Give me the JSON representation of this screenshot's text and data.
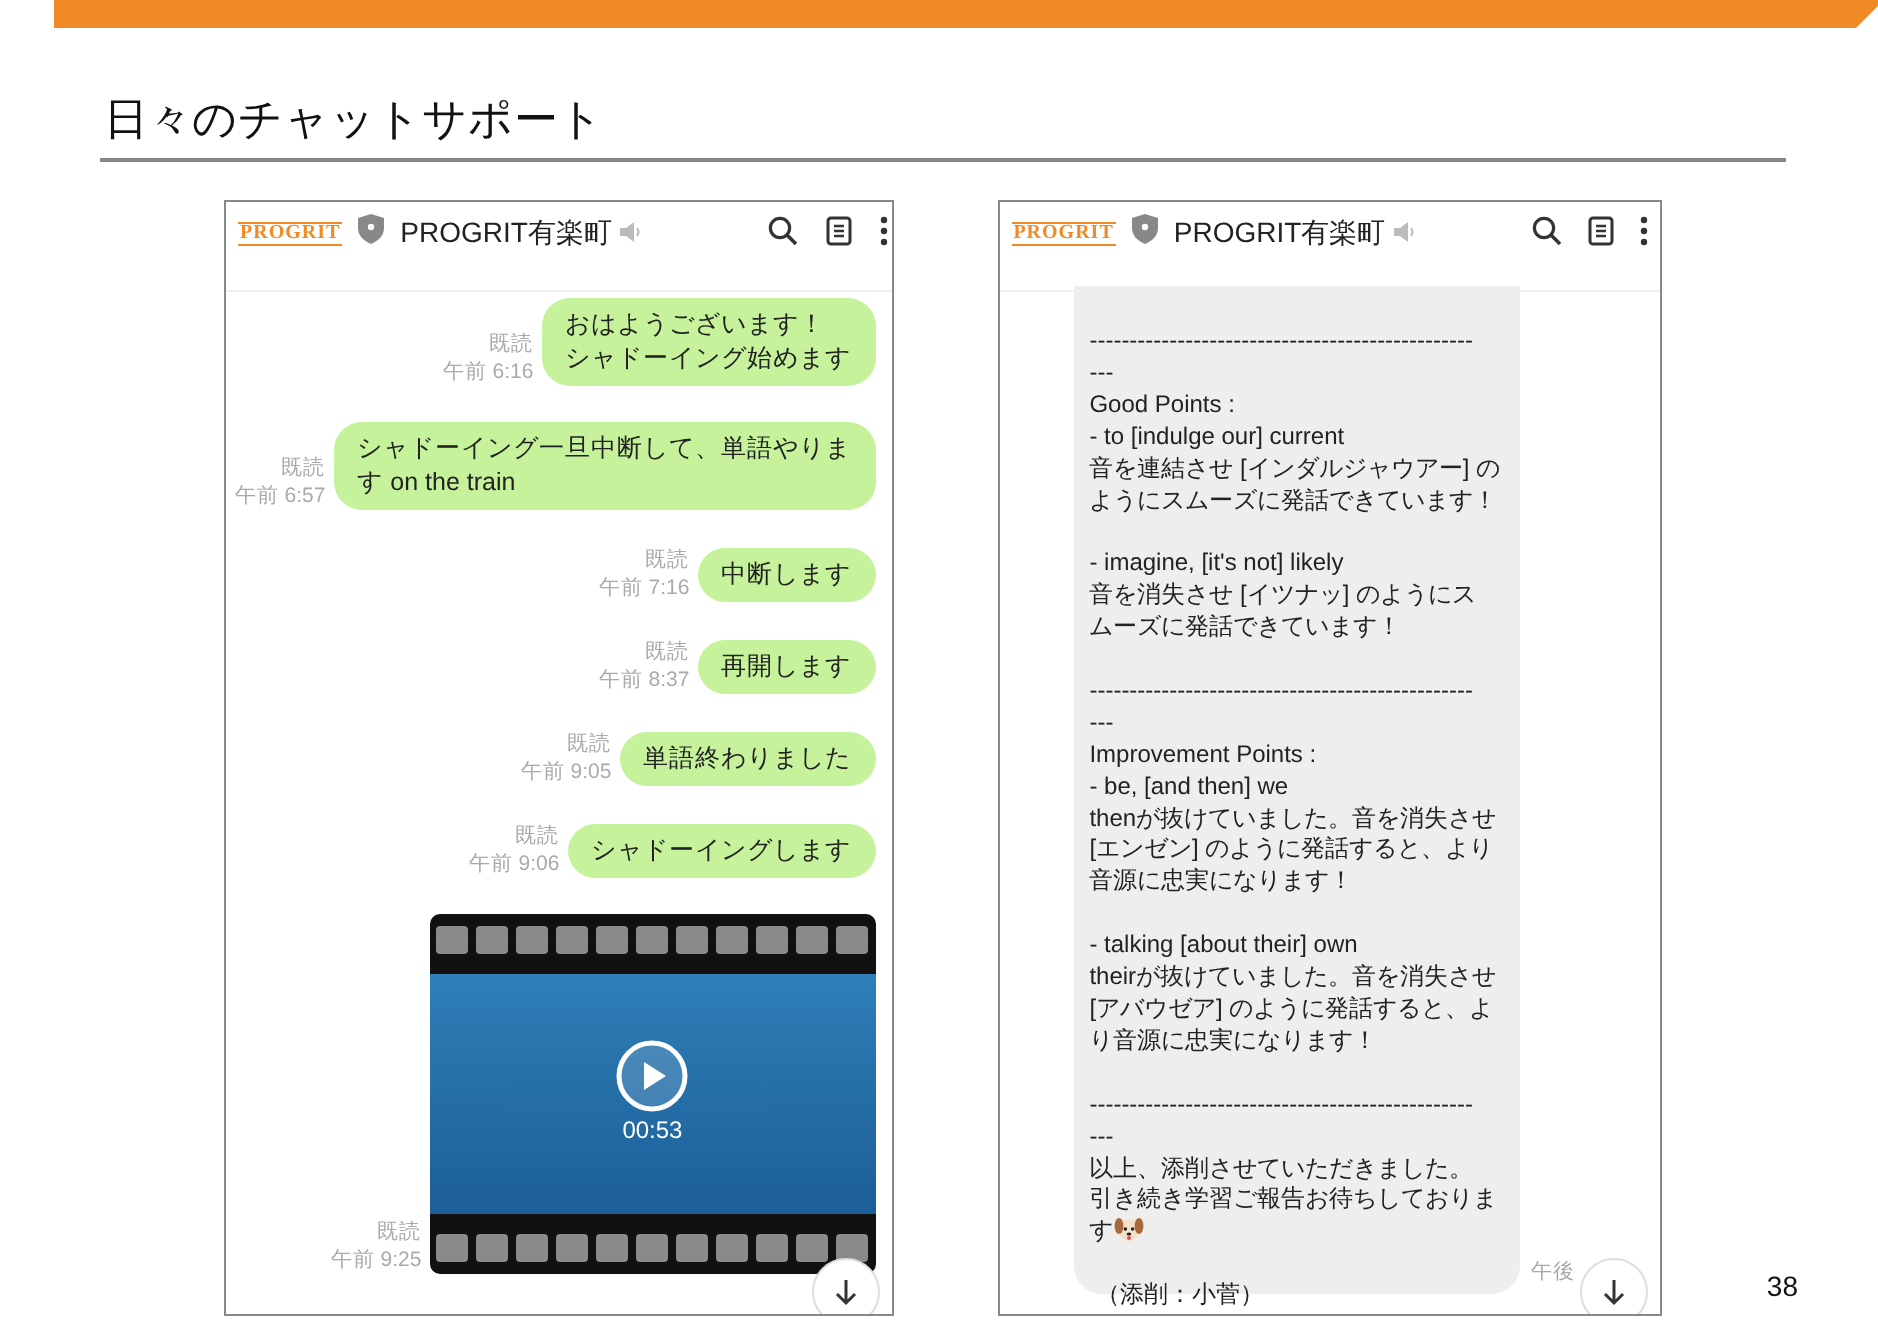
{
  "slide": {
    "title": "日々のチャットサポート",
    "page_number": "38"
  },
  "chats": [
    {
      "header": {
        "logo": "PROGRIT",
        "name": "PROGRIT有楽町"
      },
      "messages": [
        {
          "kind": "sent-text",
          "lines": [
            "おはようございます！",
            "シャドーイング始めます"
          ],
          "read": "既読",
          "time": "午前 6:16"
        },
        {
          "kind": "sent-text",
          "lines": [
            "シャドーイング一旦中断して、単語やりま",
            "す on the train"
          ],
          "read": "既読",
          "time": "午前 6:57"
        },
        {
          "kind": "sent-text",
          "lines": [
            "中断します"
          ],
          "read": "既読",
          "time": "午前 7:16"
        },
        {
          "kind": "sent-text",
          "lines": [
            "再開します"
          ],
          "read": "既読",
          "time": "午前 8:37"
        },
        {
          "kind": "sent-text",
          "lines": [
            "単語終わりました"
          ],
          "read": "既読",
          "time": "午前 9:05"
        },
        {
          "kind": "sent-text",
          "lines": [
            "シャドーイングします"
          ],
          "read": "既読",
          "time": "午前 9:06"
        },
        {
          "kind": "video",
          "duration": "00:53",
          "read": "既読",
          "time": "午前 9:25"
        }
      ]
    },
    {
      "header": {
        "logo": "PROGRIT",
        "name": "PROGRIT有楽町"
      },
      "messages": [
        {
          "kind": "received-text",
          "paragraphs": [
            [
              "------------------------------------------------",
              "---",
              "Good Points :",
              "- to [indulge our] current",
              "音を連結させ [インダルジャウアー] の",
              "ようにスムーズに発話できています！"
            ],
            [
              "- imagine, [it's not] likely",
              "音を消失させ [イツナッ] のようにス",
              "ムーズに発話できています！"
            ],
            [
              "------------------------------------------------",
              "---",
              "Improvement Points :",
              "- be, [and then] we",
              "thenが抜けていました。音を消失させ",
              "[エンゼン] のように発話すると、より",
              "音源に忠実になります！"
            ],
            [
              "- talking [about their] own",
              "theirが抜けていました。音を消失させ",
              "[アバウゼア] のように発話すると、よ",
              "り音源に忠実になります！"
            ],
            [
              "------------------------------------------------",
              "---",
              "以上、添削させていただきました。",
              "引き続き学習ご報告お待ちしておりま",
              "す"
            ]
          ],
          "signature": " （添削：小菅）",
          "time": "午後"
        }
      ]
    }
  ]
}
